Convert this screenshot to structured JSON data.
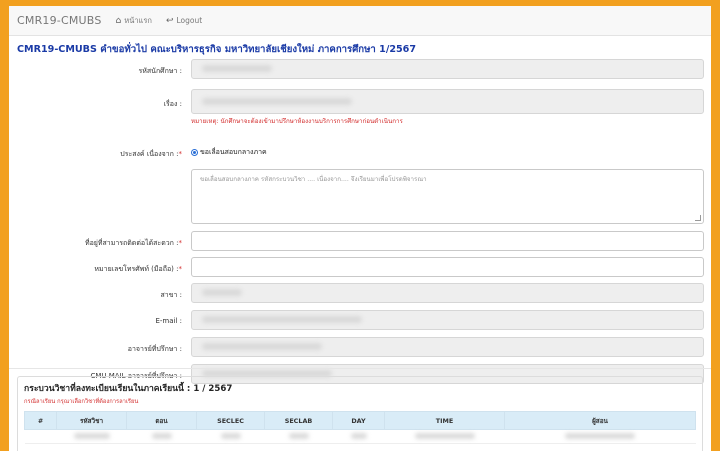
{
  "navbar": {
    "brand": "CMR19-CMUBS",
    "home_label": "หน้าแรก",
    "logout_label": "Logout"
  },
  "heading": "CMR19-CMUBS คำขอทั่วไป คณะบริหารธุรกิจ มหาวิทยาลัยเชียงใหม่ ภาคการศึกษา 1/2567",
  "form": {
    "student_id_label": "รหัสนักศึกษา :",
    "subject_label": "เรื่อง :",
    "subject_hint": "หมายเหตุ: นักศึกษาจะต้องเข้ามาปรึกษาห้องงานบริการการศึกษาก่อนดำเนินการ",
    "purpose_label": "ประสงค์ เนื่องจาก :",
    "purpose_option": "ขอเลื่อนสอบกลางภาค",
    "purpose_placeholder": "ขอเลื่อนสอบกลางภาค รหัสกระบวนวิชา .... เนื่องจาก.... จึงเรียนมาเพื่อโปรดพิจารณา",
    "address_label": "ที่อยู่ที่สามารถติดต่อได้สะดวก :",
    "phone_label": "หมายเลขโทรศัพท์ (มือถือ) :",
    "major_label": "สาขา :",
    "email_label": "E-mail :",
    "advisor_label": "อาจารย์ที่ปรึกษา :",
    "advisor_mail_label": "CMU MAIL อาจารย์ที่ปรึกษา :",
    "required_mark": "*"
  },
  "courses": {
    "title": "กระบวนวิชาที่ลงทะเบียนเรียนในภาคเรียนนี้ : 1 / 2567",
    "hint": "กรณีลาเรียน กรุณาเลือกวิชาที่ต้องการลาเรียน",
    "columns": [
      "#",
      "รหัสวิชา",
      "ตอน",
      "SECLEC",
      "SECLAB",
      "DAY",
      "TIME",
      "ผู้สอน"
    ]
  }
}
